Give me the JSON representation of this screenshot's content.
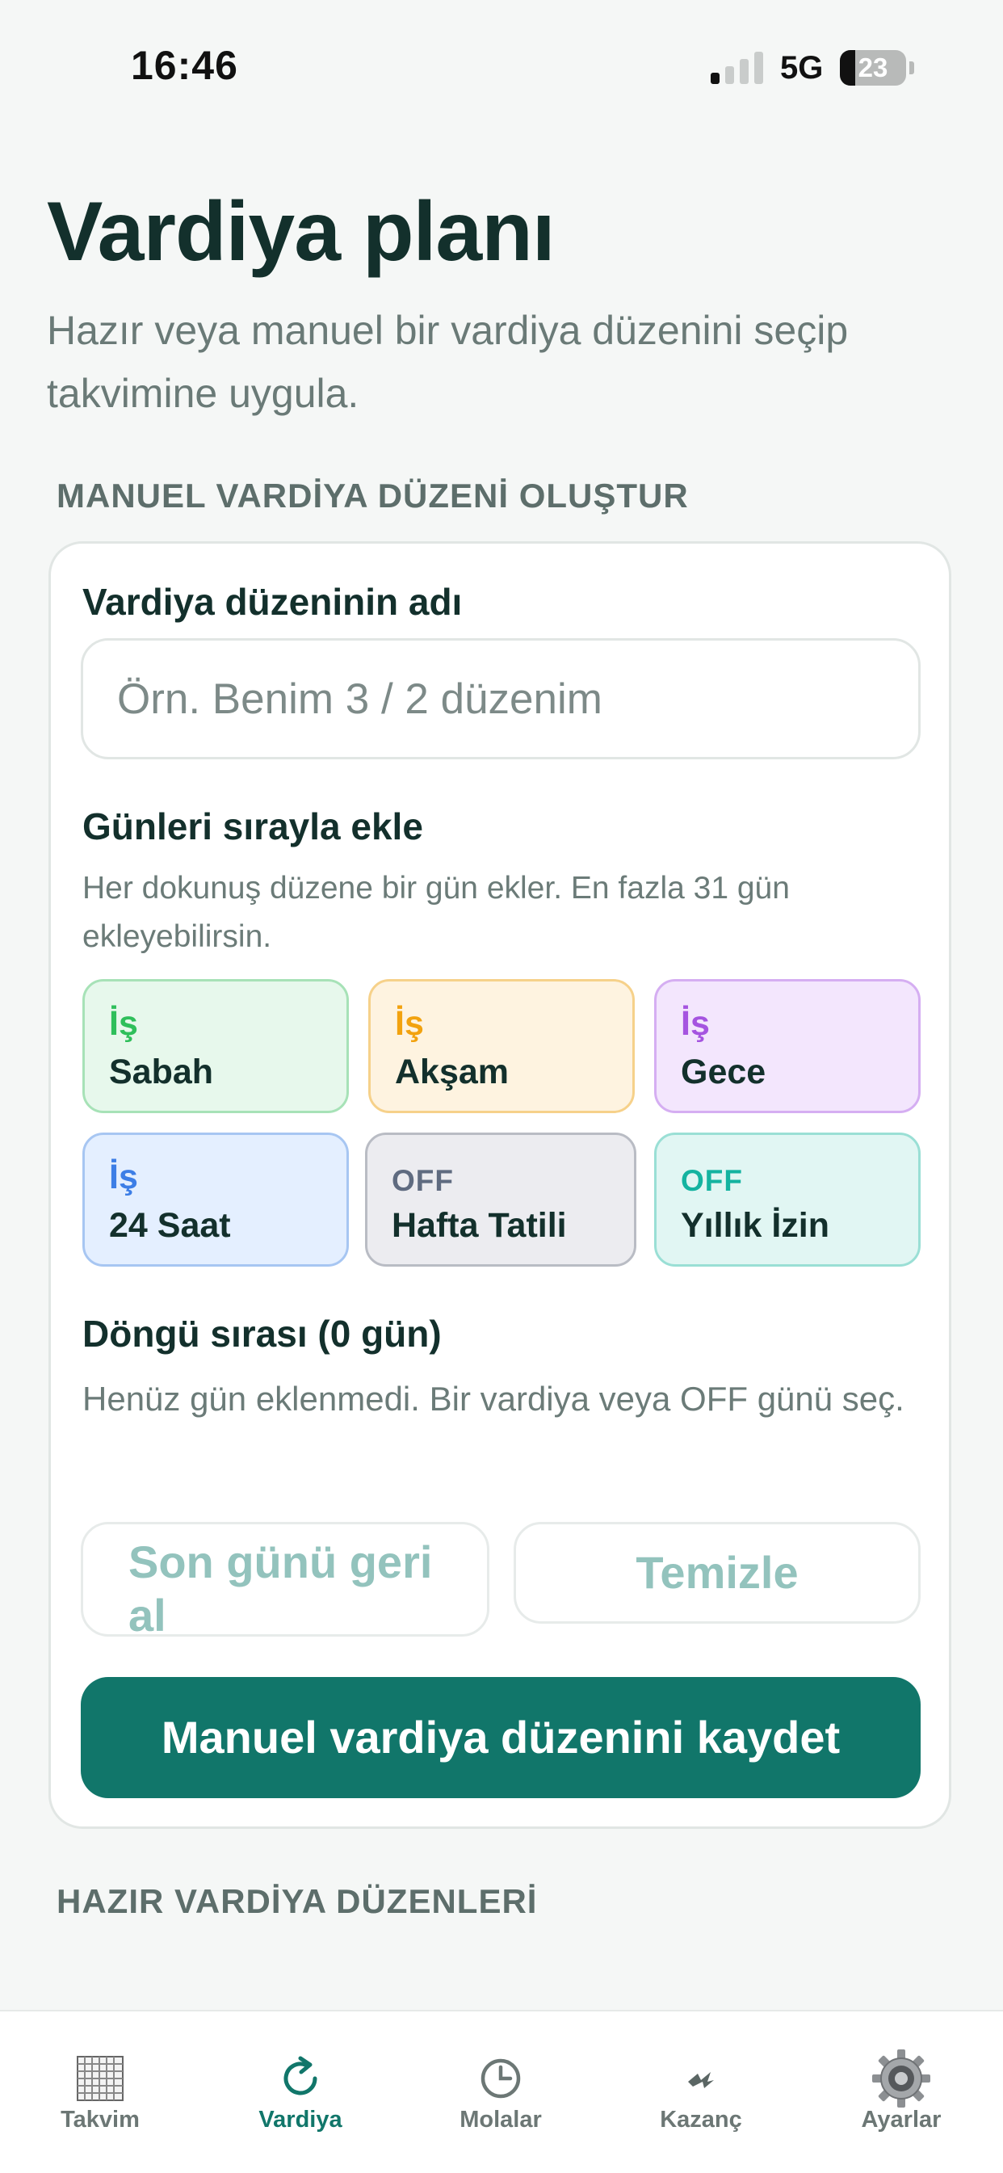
{
  "status_bar": {
    "time": "16:46",
    "network": "5G",
    "battery_pct": "23"
  },
  "header": {
    "title": "Vardiya planı",
    "subtitle": "Hazır veya manuel bir vardiya düzenini seçip takvimine uygula."
  },
  "manual_section": {
    "heading": "MANUEL VARDİYA DÜZENİ OLUŞTUR",
    "name_label": "Vardiya düzeninin adı",
    "name_value": "",
    "name_placeholder": "Örn. Benim 3 / 2 düzenim",
    "days_title": "Günleri sırayla ekle",
    "days_help": "Her dokunuş düzene bir gün ekler. En fazla 31 gün ekleyebilirsin.",
    "shift_options": [
      {
        "kind": "İş",
        "name": "Sabah",
        "color": "#2fbf5b"
      },
      {
        "kind": "İş",
        "name": "Akşam",
        "color": "#f2a20f"
      },
      {
        "kind": "İş",
        "name": "Gece",
        "color": "#a554e0"
      },
      {
        "kind": "İş",
        "name": "24 Saat",
        "color": "#3d7ee6"
      },
      {
        "kind": "OFF",
        "name": "Hafta Tatili",
        "color": "#5f6b80"
      },
      {
        "kind": "OFF",
        "name": "Yıllık İzin",
        "color": "#14b3a0"
      }
    ],
    "cycle_title": "Döngü sırası (0 gün)",
    "cycle_empty": "Henüz gün eklenmedi. Bir vardiya veya OFF günü seç.",
    "undo_label": "Son günü geri al",
    "clear_label": "Temizle",
    "save_label": "Manuel vardiya düzenini kaydet"
  },
  "presets_section": {
    "heading": "HAZIR VARDİYA DÜZENLERİ"
  },
  "tab_bar": {
    "active": "Vardiya",
    "tabs": [
      {
        "label": "Takvim",
        "icon": "calendar-grid-icon"
      },
      {
        "label": "Vardiya",
        "icon": "refresh-icon"
      },
      {
        "label": "Molalar",
        "icon": "clock-icon"
      },
      {
        "label": "Kazanç",
        "icon": "lightning-icon"
      },
      {
        "label": "Ayarlar",
        "icon": "gear-icon"
      }
    ]
  },
  "colors": {
    "accent": "#11766a",
    "title": "#13302c",
    "muted": "#6b7b78"
  }
}
